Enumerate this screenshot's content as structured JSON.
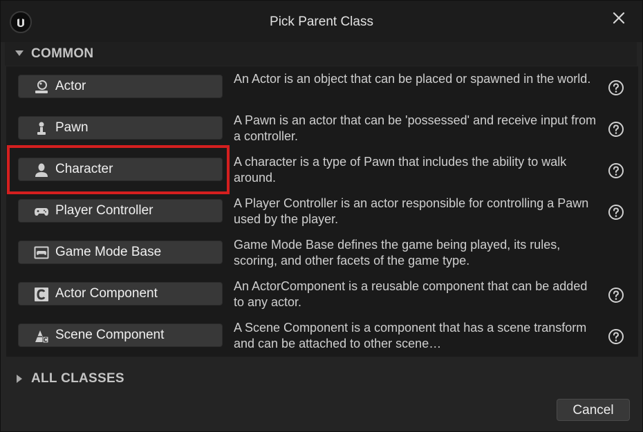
{
  "dialog": {
    "title": "Pick Parent Class"
  },
  "common": {
    "label": "COMMON"
  },
  "classes": [
    {
      "icon": "actor-icon",
      "label": "Actor",
      "description": "An Actor is an object that can be placed or spawned in the world."
    },
    {
      "icon": "pawn-icon",
      "label": "Pawn",
      "description": "A Pawn is an actor that can be 'possessed' and receive input from a controller."
    },
    {
      "icon": "character-icon",
      "label": "Character",
      "description": "A character is a type of Pawn that includes the ability to walk around."
    },
    {
      "icon": "gamepad-icon",
      "label": "Player Controller",
      "description": "A Player Controller is an actor responsible for controlling a Pawn used by the player."
    },
    {
      "icon": "game-mode-icon",
      "label": "Game Mode Base",
      "description": "Game Mode Base defines the game being played, its rules, scoring, and other facets of the game type."
    },
    {
      "icon": "actor-component-icon",
      "label": "Actor Component",
      "description": "An ActorComponent is a reusable component that can be added to any actor."
    },
    {
      "icon": "scene-component-icon",
      "label": "Scene Component",
      "description": "A Scene Component is a component that has a scene transform and can be attached to other scene…"
    }
  ],
  "all_classes": {
    "label": "ALL CLASSES"
  },
  "footer": {
    "cancel_label": "Cancel"
  },
  "colors": {
    "highlight": "#d41f1f",
    "button": "#383838",
    "panel": "#1a1a1a"
  }
}
